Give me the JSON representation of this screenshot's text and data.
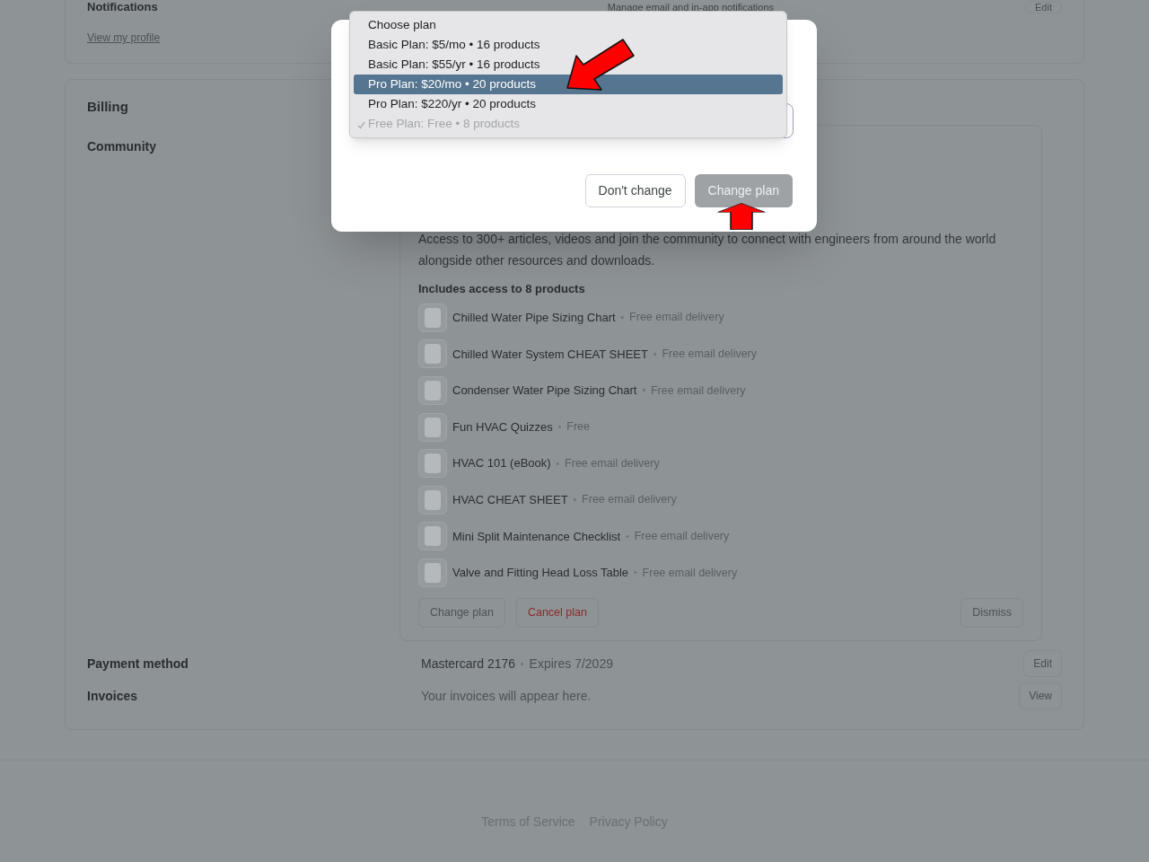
{
  "notifications": {
    "title": "Notifications",
    "description": "Manage email and in-app notifications",
    "link": "View my profile",
    "edit_button": "Edit"
  },
  "billing": {
    "title": "Billing",
    "plan_label": "Community",
    "plan_card": {
      "description": "Access to 300+ articles, videos and join the community to connect with engineers from around the world alongside other resources and downloads.",
      "includes_heading": "Includes access to 8 products",
      "products": [
        {
          "name": "Chilled Water Pipe Sizing Chart",
          "separator": "•",
          "delivery": "Free email delivery"
        },
        {
          "name": "Chilled Water System CHEAT SHEET",
          "separator": "•",
          "delivery": "Free email delivery"
        },
        {
          "name": "Condenser Water Pipe Sizing Chart",
          "separator": "•",
          "delivery": "Free email delivery"
        },
        {
          "name": "Fun HVAC Quizzes",
          "separator": "•",
          "delivery": "Free"
        },
        {
          "name": "HVAC 101 (eBook)",
          "separator": "•",
          "delivery": "Free email delivery"
        },
        {
          "name": "HVAC CHEAT SHEET",
          "separator": "•",
          "delivery": "Free email delivery"
        },
        {
          "name": "Mini Split Maintenance Checklist",
          "separator": "•",
          "delivery": "Free email delivery"
        },
        {
          "name": "Valve and Fitting Head Loss Table",
          "separator": "•",
          "delivery": "Free email delivery"
        }
      ],
      "change_button": "Change plan",
      "cancel_button": "Cancel plan",
      "dismiss_button": "Dismiss"
    },
    "payment": {
      "label": "Payment method",
      "card": "Mastercard 2176",
      "separator": "•",
      "expiry": "Expires 7/2029",
      "button": "Edit"
    },
    "invoices": {
      "label": "Invoices",
      "text": "Your invoices will appear here.",
      "button": "View"
    }
  },
  "footer": {
    "links": [
      "Terms of Service",
      "Privacy Policy"
    ]
  },
  "modal": {
    "dropdown": {
      "options": [
        {
          "label": "Choose plan",
          "selected": false,
          "checked": false,
          "disabled": false
        },
        {
          "label": "Basic Plan: $5/mo • 16 products",
          "selected": false,
          "checked": false,
          "disabled": false
        },
        {
          "label": "Basic Plan: $55/yr • 16 products",
          "selected": false,
          "checked": false,
          "disabled": false
        },
        {
          "label": "Pro Plan: $20/mo • 20 products",
          "selected": true,
          "checked": false,
          "disabled": false
        },
        {
          "label": "Pro Plan: $220/yr • 20 products",
          "selected": false,
          "checked": false,
          "disabled": false
        },
        {
          "label": "Free Plan: Free • 8 products",
          "selected": false,
          "checked": true,
          "disabled": true
        }
      ]
    },
    "cancel_button": "Don't change",
    "confirm_button": {
      "label": "Change plan",
      "disabled": true
    }
  }
}
